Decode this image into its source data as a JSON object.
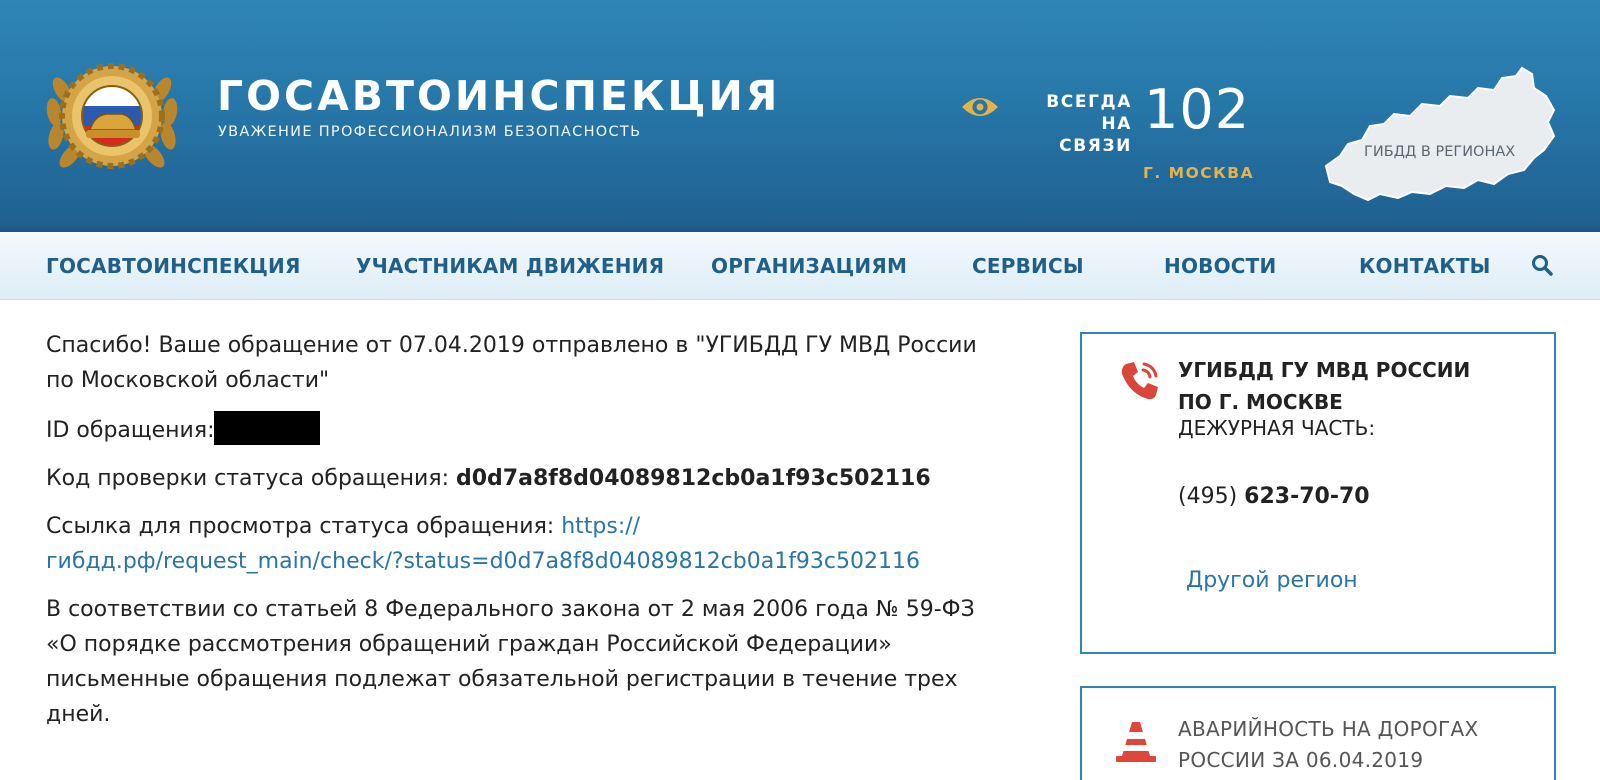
{
  "header": {
    "title": "ГОСАВТОИНСПЕКЦИЯ",
    "slogan": "УВАЖЕНИЕ ПРОФЕССИОНАЛИЗМ БЕЗОПАСНОСТЬ",
    "hotline_label_line1": "ВСЕГДА",
    "hotline_label_line2": "НА СВЯЗИ",
    "hotline_number": "102",
    "city": "Г. МОСКВА",
    "regions_label": "ГИБДД В РЕГИОНАХ",
    "icons": {
      "emblem": "gibdd-emblem",
      "eye": "eye-icon",
      "map": "russia-map"
    },
    "colors": {
      "header_bg": "#2677a8",
      "accent_gold": "#e6b24a"
    }
  },
  "nav": {
    "items": [
      {
        "label": "ГОСАВТОИНСПЕКЦИЯ"
      },
      {
        "label": "УЧАСТНИКАМ ДВИЖЕНИЯ"
      },
      {
        "label": "ОРГАНИЗАЦИЯМ"
      },
      {
        "label": "СЕРВИСЫ"
      },
      {
        "label": "НОВОСТИ"
      },
      {
        "label": "КОНТАКТЫ"
      }
    ],
    "search_icon": "search-icon"
  },
  "main": {
    "thanks_text": "Спасибо! Ваше обращение от 07.04.2019 отправлено в \"УГИБДД ГУ МВД России по Московской области\"",
    "id_label": "ID обращения:",
    "code_label": "Код проверки статуса обращения: ",
    "code_value": "d0d7a8f8d04089812cb0a1f93c502116",
    "link_label": "Ссылка для просмотра статуса обращения: ",
    "link_value": "https://гибдд.рф/request_main/check/?status=d0d7a8f8d04089812cb0a1f93c502116",
    "law_text": "В соответствии со статьей 8 Федерального закона от 2 мая 2006 года № 59-ФЗ «О порядке рассмотрения обращений граждан Российской Федерации» письменные обращения подлежат обязательной регистрации в течение трех дней."
  },
  "sidebar": {
    "contact": {
      "org_name": "УГИБДД ГУ МВД РОССИИ ПО Г. МОСКВЕ",
      "duty_label": "ДЕЖУРНАЯ ЧАСТЬ:",
      "phone_code": "(495) ",
      "phone_number": "623-70-70",
      "other_region": "Другой регион",
      "icon": "phone-icon"
    },
    "accidents": {
      "title": "АВАРИЙНОСТЬ НА ДОРОГАХ РОССИИ ЗА 06.04.2019",
      "icon": "traffic-cone-icon"
    }
  }
}
